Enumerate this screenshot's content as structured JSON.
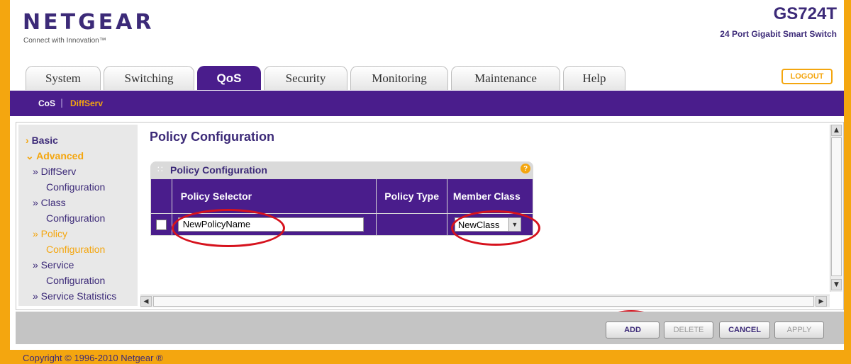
{
  "brand": {
    "logo": "NETGEAR",
    "tagline": "Connect with Innovation™",
    "model": "GS724T",
    "model_desc": "24 Port Gigabit Smart Switch"
  },
  "tabs": [
    {
      "label": "System"
    },
    {
      "label": "Switching"
    },
    {
      "label": "QoS"
    },
    {
      "label": "Security"
    },
    {
      "label": "Monitoring"
    },
    {
      "label": "Maintenance"
    },
    {
      "label": "Help"
    }
  ],
  "active_tab": "QoS",
  "logout_label": "LOGOUT",
  "subnav": {
    "items": [
      "CoS",
      "DiffServ"
    ],
    "separator": "|",
    "active": "DiffServ"
  },
  "sidebar": {
    "basic": "Basic",
    "advanced": "Advanced",
    "items": [
      {
        "line1": "» DiffServ",
        "line2": "Configuration"
      },
      {
        "line1": "» Class",
        "line2": "Configuration"
      },
      {
        "line1": "» Policy",
        "line2": "Configuration"
      },
      {
        "line1": "» Service",
        "line2": "Configuration"
      },
      {
        "line1": "» Service Statistics"
      }
    ],
    "active_item": "Policy Configuration"
  },
  "main": {
    "page_title": "Policy Configuration",
    "panel_title": "Policy Configuration",
    "help_glyph": "?",
    "table": {
      "headers": [
        "Policy Selector",
        "Policy Type",
        "Member Class"
      ],
      "row": {
        "policy_selector_value": "NewPolicyName",
        "policy_type": "",
        "member_class_value": "NewClass"
      }
    }
  },
  "buttons": {
    "add": "ADD",
    "delete": "DELETE",
    "cancel": "CANCEL",
    "apply": "APPLY"
  },
  "footer": {
    "copyright": "Copyright © 1996-2010 Netgear ®"
  },
  "colors": {
    "brand_purple": "#4a1d8c",
    "accent_orange": "#f4a60f",
    "annotation_red": "#d6121d"
  }
}
